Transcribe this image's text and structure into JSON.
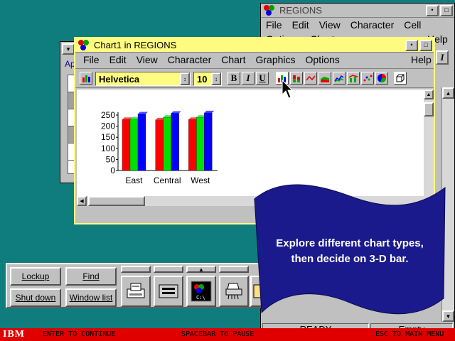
{
  "regions_window": {
    "title": "REGIONS",
    "menu": [
      "File",
      "Edit",
      "View",
      "Character",
      "Cell"
    ],
    "menu_row2": [
      "Options",
      "Chart"
    ],
    "help": "Help",
    "status_ready": "READY",
    "status_empty": "Empty"
  },
  "chart_window": {
    "title": "Chart1  in REGIONS",
    "menu": [
      "File",
      "Edit",
      "View",
      "Character",
      "Chart",
      "Graphics",
      "Options"
    ],
    "help": "Help",
    "font_name": "Helvetica",
    "font_size": "10",
    "bold": "B",
    "italic": "I",
    "underline": "U",
    "tools": [
      "bar-chart-icon",
      "stacked-bar-icon",
      "line-chart-icon",
      "area-chart-icon",
      "hi-lo-icon",
      "line-bar-icon",
      "scatter-icon",
      "pie-chart-icon",
      "3d-box-icon"
    ]
  },
  "back_window": {
    "label_ap": "Ap"
  },
  "chart_data": {
    "type": "bar",
    "categories": [
      "East",
      "Central",
      "West"
    ],
    "series": [
      {
        "values": [
          230,
          228,
          230
        ],
        "color": "#ff0000"
      },
      {
        "values": [
          232,
          240,
          240
        ],
        "color": "#00e000"
      },
      {
        "values": [
          255,
          258,
          260
        ],
        "color": "#0000ff"
      }
    ],
    "yticks": [
      "250",
      "200",
      "150",
      "100",
      "50",
      "0"
    ],
    "ylim": [
      0,
      250
    ]
  },
  "launchpad": {
    "buttons": [
      "Lockup",
      "Find",
      "Shut down",
      "Window list"
    ],
    "icons": [
      "printer-icon",
      "drives-icon",
      "os2-window-icon",
      "shredder-icon",
      "folder-icon"
    ]
  },
  "tip_flag": {
    "line1": "Explore different chart types,",
    "line2": "then decide on 3-D bar."
  },
  "footer": {
    "logo": "IBM",
    "continue": "ENTER TO CONTINUE",
    "pause": "SPACEBAR TO PAUSE",
    "menu": "ESC TO MAIN MENU"
  },
  "colors": {
    "desktop": "#0f7d7d",
    "active_title": "#fffb80",
    "flag": "#1a1a8c",
    "footer": "#e00000"
  }
}
